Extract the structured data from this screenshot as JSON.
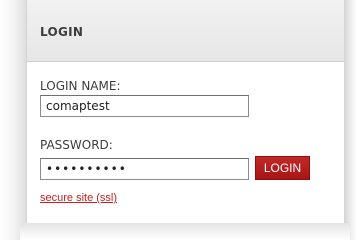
{
  "panel": {
    "title": "LOGIN"
  },
  "form": {
    "login_name_label": "LOGIN NAME:",
    "login_name_value": "comaptest",
    "password_label": "PASSWORD:",
    "password_value": "••••••••••",
    "submit_label": "LOGIN"
  },
  "links": {
    "secure_site": "secure site (ssl)"
  },
  "colors": {
    "accent": "#b01a1a",
    "link": "#cc1f1f",
    "header_bg": "#ececec",
    "text": "#3c3c3c"
  }
}
